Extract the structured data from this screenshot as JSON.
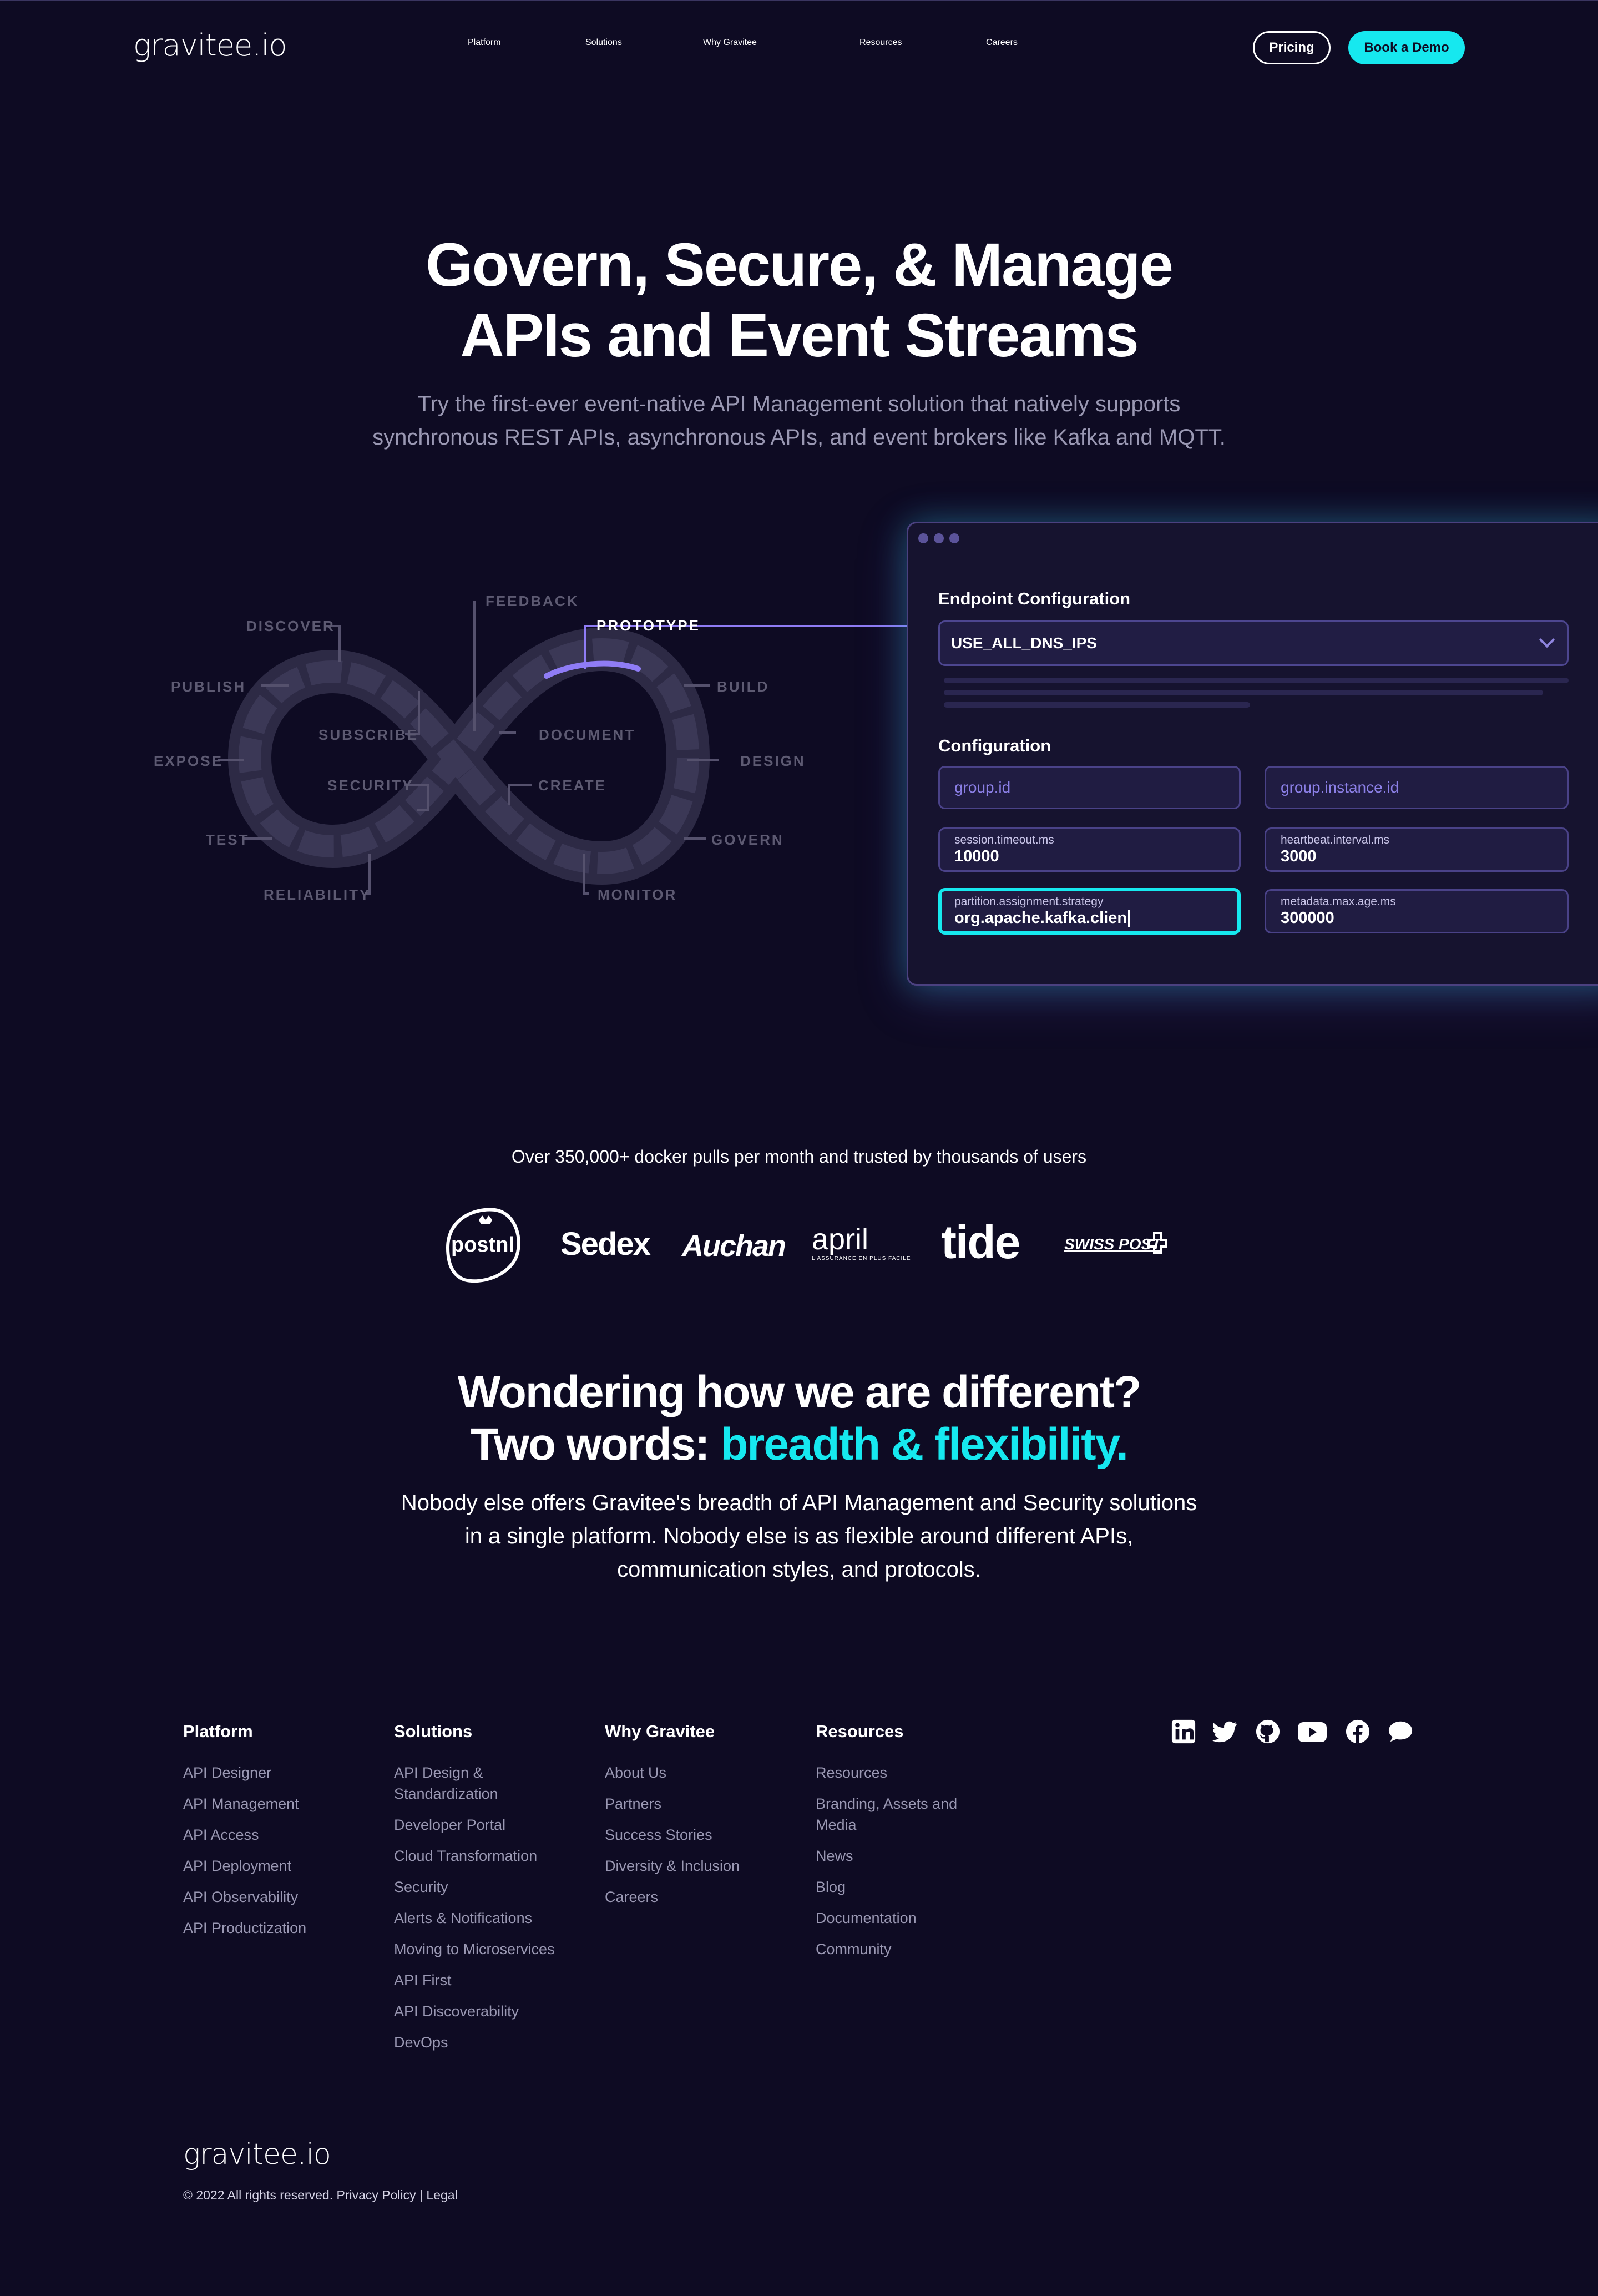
{
  "header": {
    "logo": "gravitee",
    "logo_suffix": ".io",
    "nav": [
      "Platform",
      "Solutions",
      "Why Gravitee",
      "Resources",
      "Careers"
    ],
    "pricing_label": "Pricing",
    "demo_label": "Book a Demo"
  },
  "hero": {
    "title_line1": "Govern, Secure, & Manage",
    "title_line2": "APIs and Event Streams",
    "subtitle_line1": "Try the first-ever event-native API Management solution that natively supports",
    "subtitle_line2": "synchronous REST APIs, asynchronous APIs, and event brokers like Kafka and MQTT."
  },
  "infinity": {
    "discover": "DISCOVER",
    "feedback": "FEEDBACK",
    "prototype": "PROTOTYPE",
    "publish": "PUBLISH",
    "build": "BUILD",
    "subscribe": "SUBSCRIBE",
    "document": "DOCUMENT",
    "expose": "EXPOSE",
    "design": "DESIGN",
    "security": "SECURITY",
    "create": "CREATE",
    "test": "TEST",
    "govern": "GOVERN",
    "reliability": "RELIABILITY",
    "monitor": "MONITOR"
  },
  "config_card": {
    "endpoint_heading": "Endpoint Configuration",
    "endpoint_value": "USE_ALL_DNS_IPS",
    "config_heading": "Configuration",
    "fields": {
      "group_id": "group.id",
      "group_instance_id": "group.instance.id",
      "session_key": "session.timeout.ms",
      "session_value": "10000",
      "heartbeat_key": "heartbeat.interval.ms",
      "heartbeat_value": "3000",
      "partition_key": "partition.assignment.strategy",
      "partition_value": "org.apache.kafka.clien",
      "metadata_key": "metadata.max.age.ms",
      "metadata_value": "300000"
    }
  },
  "trusted": {
    "text": "Over 350,000+ docker pulls per month and trusted by thousands of users",
    "logos": {
      "postnl": "postnl",
      "sedex": "Sedex",
      "auchan": "Auchan",
      "april": "april",
      "april_tag": "L'ASSURANCE EN PLUS FACILE",
      "tide": "tide",
      "swisspost": "SWISS POST"
    }
  },
  "different": {
    "title_line1": "Wondering how we are different?",
    "title_line2_prefix": "Two words: ",
    "title_line2_highlight": "breadth & flexibility.",
    "body_line1": "Nobody else offers Gravitee's breadth of API Management and Security solutions",
    "body_line2": "in a single platform. Nobody else is as flexible around different APIs,",
    "body_line3": "communication styles, and protocols."
  },
  "footer": {
    "columns": [
      {
        "heading": "Platform",
        "links": [
          "API Designer",
          "API Management",
          "API Access",
          "API Deployment",
          "API Observability",
          "API Productization"
        ]
      },
      {
        "heading": "Solutions",
        "links": [
          "API Design & Standardization",
          "Developer Portal",
          "Cloud Transformation",
          "Security",
          "Alerts & Notifications",
          "Moving to Microservices",
          "API First",
          "API Discoverability",
          "DevOps"
        ]
      },
      {
        "heading": "Why Gravitee",
        "links": [
          "About Us",
          "Partners",
          "Success Stories",
          "Diversity & Inclusion",
          "Careers"
        ]
      },
      {
        "heading": "Resources",
        "links": [
          "Resources",
          "Branding, Assets and Media",
          "News",
          "Blog",
          "Documentation",
          "Community"
        ]
      }
    ],
    "social": [
      "linkedin-icon",
      "twitter-icon",
      "github-icon",
      "youtube-icon",
      "facebook-icon",
      "chat-icon"
    ],
    "logo": "gravitee",
    "logo_suffix": ".io",
    "copyright": "© 2022 All rights reserved. Privacy Policy | Legal"
  },
  "colors": {
    "background": "#0e0b23",
    "accent": "#16e8ef",
    "purple": "#7b6fe0"
  }
}
